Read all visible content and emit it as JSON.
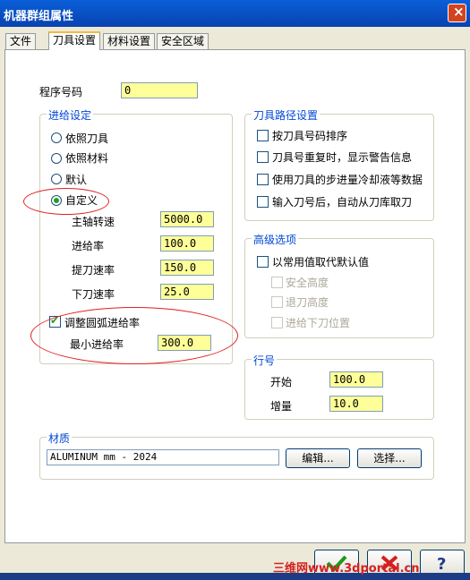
{
  "window": {
    "title": "机器群组属性"
  },
  "tabs": [
    "文件",
    "刀具设置",
    "材料设置",
    "安全区域"
  ],
  "program": {
    "label": "程序号码",
    "value": "0"
  },
  "feed": {
    "group_label": "进给设定",
    "options": [
      "依照刀具",
      "依照材料",
      "默认",
      "自定义"
    ],
    "spindle_label": "主轴转速",
    "spindle_value": "5000.0",
    "feed_label": "进给率",
    "feed_value": "100.0",
    "retract_label": "提刀速率",
    "retract_value": "150.0",
    "plunge_label": "下刀速率",
    "plunge_value": "25.0",
    "arc_label": "调整圆弧进给率",
    "min_label": "最小进给率",
    "min_value": "300.0"
  },
  "path": {
    "group_label": "刀具路径设置",
    "items": [
      "按刀具号码排序",
      "刀具号重复时，显示警告信息",
      "使用刀具的步进量冷却液等数据",
      "输入刀号后，自动从刀库取刀"
    ]
  },
  "advanced": {
    "group_label": "高级选项",
    "main_label": "以常用值取代默认值",
    "items": [
      "安全高度",
      "退刀高度",
      "进给下刀位置"
    ]
  },
  "line_numbers": {
    "group_label": "行号",
    "start_label": "开始",
    "start_value": "100.0",
    "inc_label": "增量",
    "inc_value": "10.0"
  },
  "material": {
    "group_label": "材质",
    "value": "ALUMINUM mm - 2024",
    "edit_label": "编辑...",
    "select_label": "选择..."
  },
  "watermark": "三维网www.3dportal.cn"
}
